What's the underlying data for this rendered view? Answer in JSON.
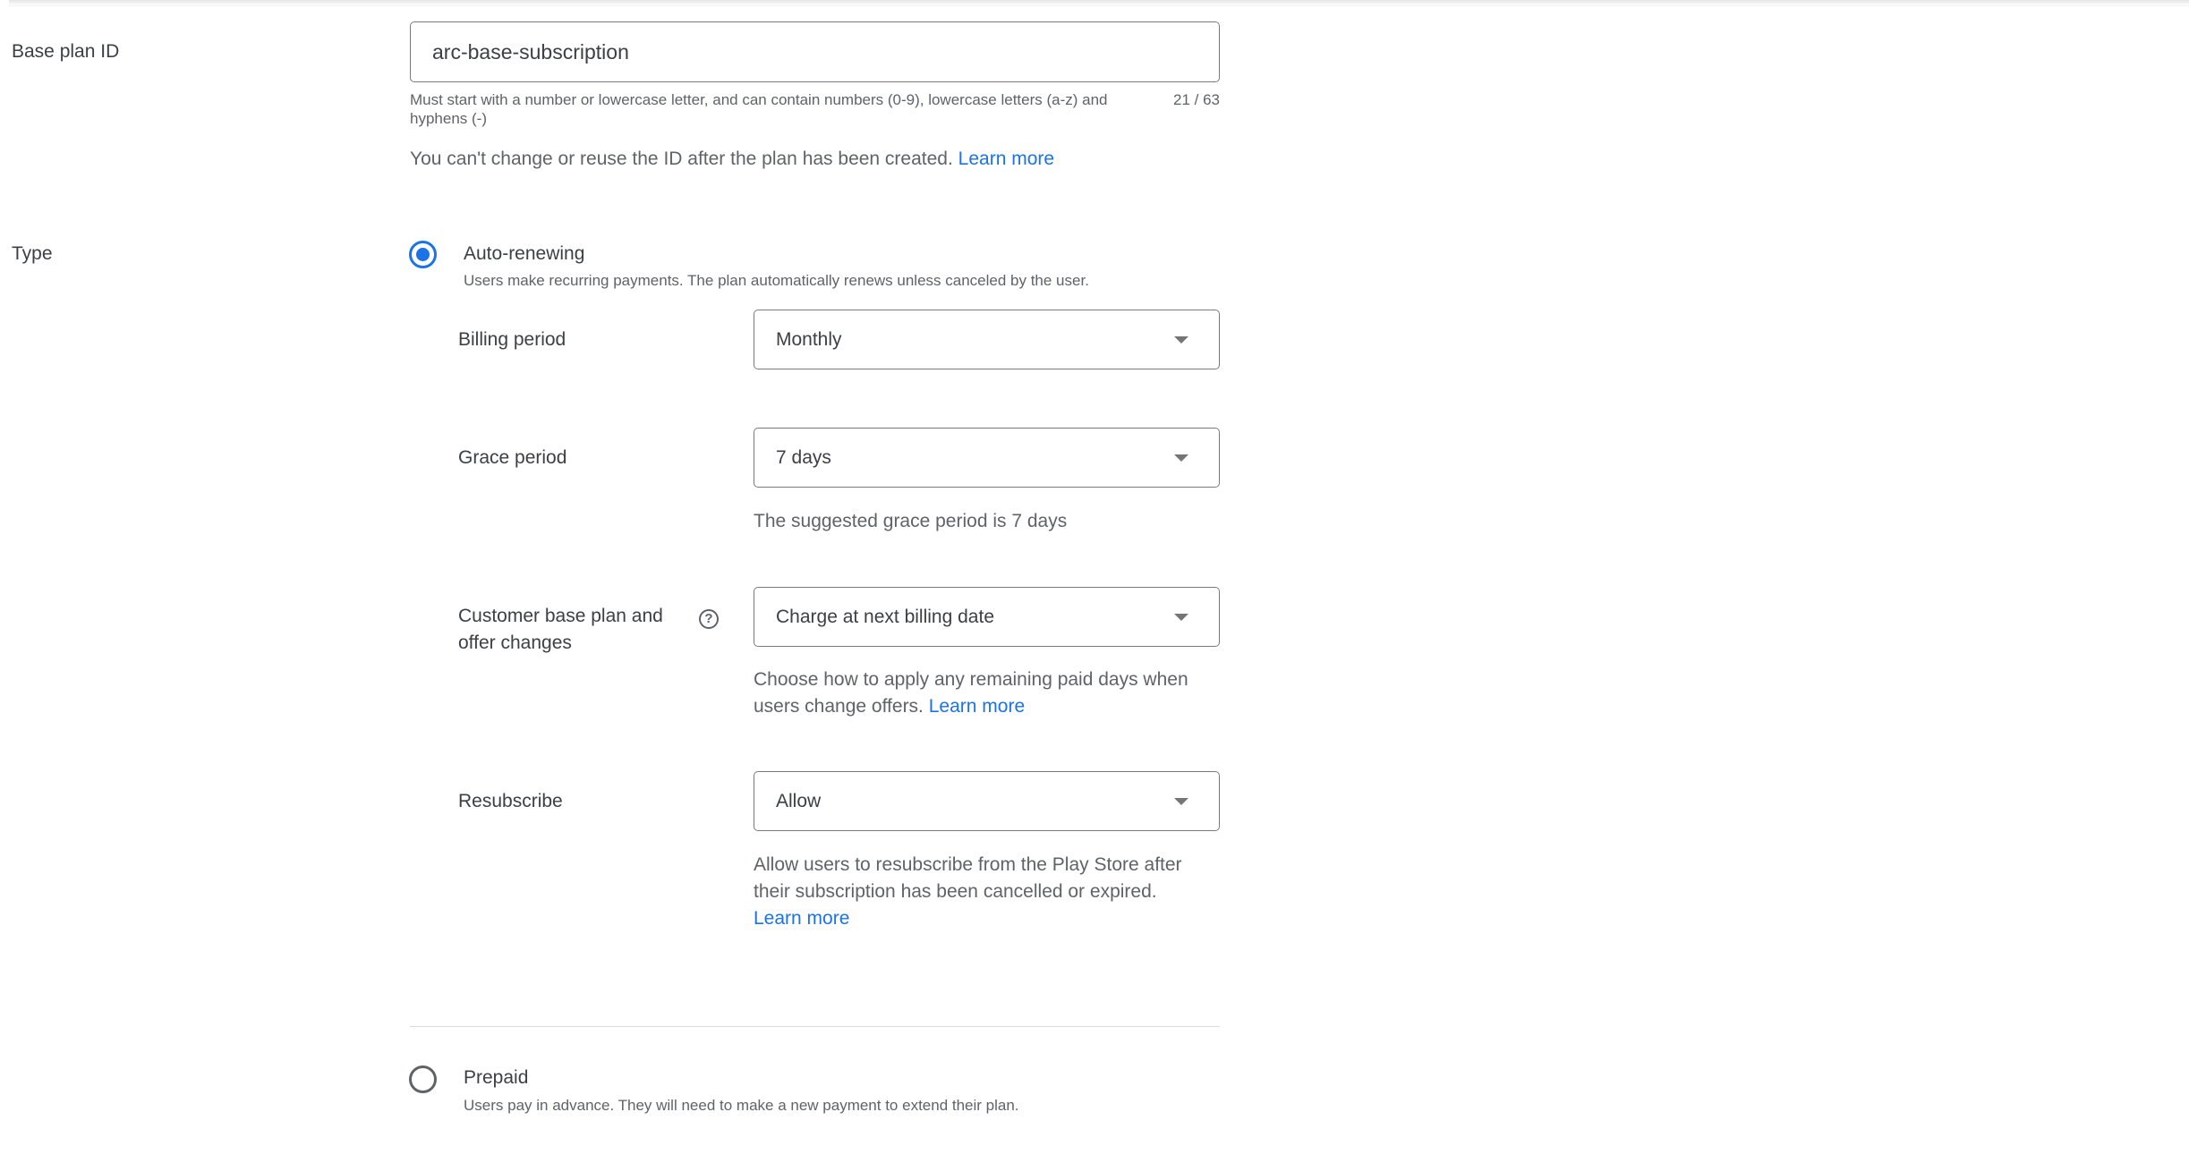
{
  "base_plan_id": {
    "label": "Base plan ID",
    "value": "arc-base-subscription",
    "helper": "Must start with a number or lowercase letter, and can contain numbers (0-9), lowercase letters (a-z) and hyphens (-)",
    "counter": "21 / 63",
    "note": "You can't change or reuse the ID after the plan has been created.",
    "note_link": "Learn more"
  },
  "type": {
    "label": "Type",
    "options": [
      {
        "label": "Auto-renewing",
        "description": "Users make recurring payments. The plan automatically renews unless canceled by the user.",
        "selected": true
      },
      {
        "label": "Prepaid",
        "description": "Users pay in advance. They will need to make a new payment to extend their plan.",
        "selected": false
      }
    ]
  },
  "auto_renewing": {
    "billing_period": {
      "label": "Billing period",
      "value": "Monthly"
    },
    "grace_period": {
      "label": "Grace period",
      "value": "7 days",
      "hint": "The suggested grace period is 7 days"
    },
    "plan_changes": {
      "label": "Customer base plan and offer changes",
      "value": "Charge at next billing date",
      "hint": "Choose how to apply any remaining paid days when users change offers.",
      "hint_link": "Learn more"
    },
    "resubscribe": {
      "label": "Resubscribe",
      "value": "Allow",
      "hint": "Allow users to resubscribe from the Play Store after their subscription has been cancelled or expired.",
      "hint_link": "Learn more"
    }
  },
  "colors": {
    "accent": "#1a73e8",
    "text": "#3c4043",
    "secondary_text": "#5f6368",
    "border": "#7a7a7a",
    "divider": "#dadce0"
  }
}
